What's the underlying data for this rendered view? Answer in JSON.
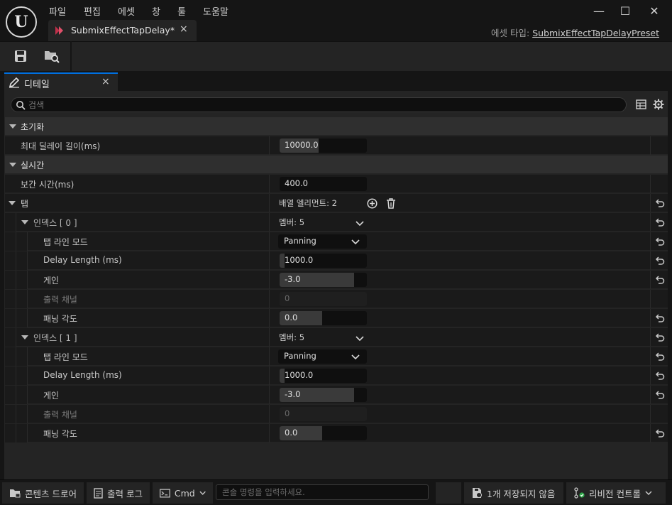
{
  "menu": [
    "파일",
    "편집",
    "에셋",
    "창",
    "툴",
    "도움말"
  ],
  "logo_text": "U",
  "doc_tab": {
    "label": "SubmixEffectTapDelay*",
    "close": "×"
  },
  "window": {
    "minimize": "—",
    "maximize": "☐",
    "close": "✕"
  },
  "asset_type": {
    "label": "에셋 타입: ",
    "value": "SubmixEffectTapDelayPreset"
  },
  "details_tab": {
    "label": "디테일",
    "close": "×"
  },
  "search": {
    "placeholder": "검색"
  },
  "categories": {
    "init": "초기화",
    "realtime": "실시간",
    "taps": "탭"
  },
  "props": {
    "max_delay": {
      "label": "최대 딜레이 길이(ms)",
      "value": "10000.0",
      "fill": 0.45
    },
    "interp_time": {
      "label": "보간 시간(ms)",
      "value": "400.0"
    },
    "taps_info": "배열 엘리먼트: 2"
  },
  "taps": [
    {
      "index_label": "인덱스 [ 0 ]",
      "members": "멤버: 5",
      "mode_label": "탭 라인 모드",
      "mode_value": "Panning",
      "delay_label": "Delay Length (ms)",
      "delay_value": "1000.0",
      "delay_fill": 0.06,
      "gain_label": "게인",
      "gain_value": "-3.0",
      "gain_fill": 0.85,
      "channel_label": "출력 채널",
      "channel_value": "0",
      "pan_label": "패닝 각도",
      "pan_value": "0.0",
      "pan_fill": 0.49
    },
    {
      "index_label": "인덱스 [ 1 ]",
      "members": "멤버: 5",
      "mode_label": "탭 라인 모드",
      "mode_value": "Panning",
      "delay_label": "Delay Length (ms)",
      "delay_value": "1000.0",
      "delay_fill": 0.06,
      "gain_label": "게인",
      "gain_value": "-3.0",
      "gain_fill": 0.85,
      "channel_label": "출력 채널",
      "channel_value": "0",
      "pan_label": "패닝 각도",
      "pan_value": "0.0",
      "pan_fill": 0.49
    }
  ],
  "statusbar": {
    "content_drawer": "콘텐츠 드로어",
    "output_log": "출력 로그",
    "cmd": "Cmd",
    "console_placeholder": "콘솔 명령을 입력하세요.",
    "unsaved": "1개 저장되지 않음",
    "revision": "리비전 컨트롤"
  },
  "colors": {
    "accent": "#0070e0",
    "panel": "#242424",
    "row": "#1a1a1a",
    "category": "#2f2f2f",
    "field": "#0f0f0f"
  }
}
